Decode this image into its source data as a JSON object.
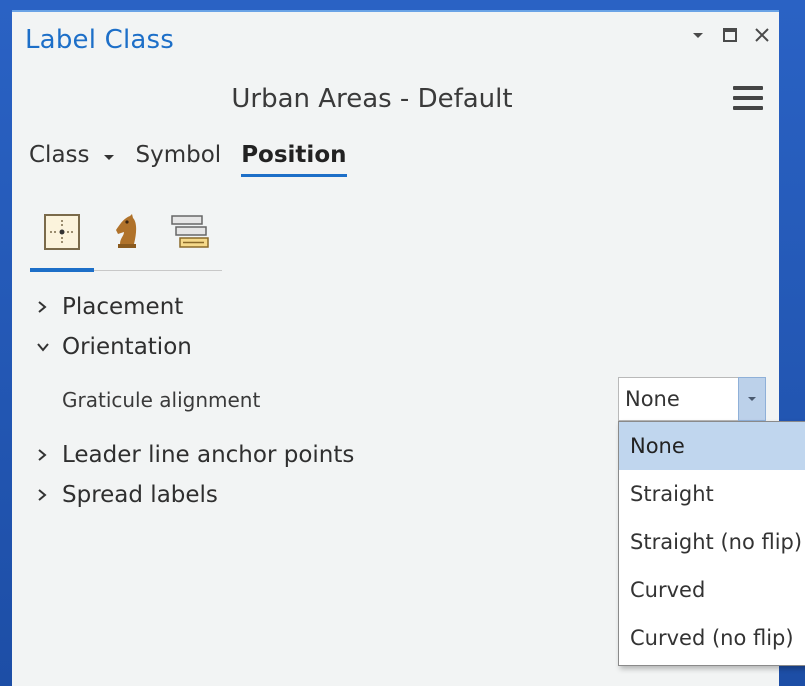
{
  "pane": {
    "title": "Label Class",
    "controls": [
      "dropdown-caret-icon",
      "maximize-icon",
      "close-icon"
    ]
  },
  "layer_title": "Urban Areas - Default",
  "tabs": [
    {
      "label": "Class"
    },
    {
      "label": "Symbol"
    },
    {
      "label": "Position",
      "active": true
    }
  ],
  "subtabs": [
    "placement-position-icon",
    "chess-knight-icon",
    "text-stack-icon"
  ],
  "sections": {
    "placement": "Placement",
    "orientation": "Orientation",
    "leader": "Leader line anchor points",
    "spread": "Spread labels"
  },
  "graticule": {
    "label": "Graticule alignment",
    "value": "None",
    "options": [
      "None",
      "Straight",
      "Straight (no flip)",
      "Curved",
      "Curved (no flip)"
    ]
  },
  "colors": {
    "accent": "#1d6fc8",
    "selection": "#c0d6ee",
    "background": "#f2f4f4"
  }
}
